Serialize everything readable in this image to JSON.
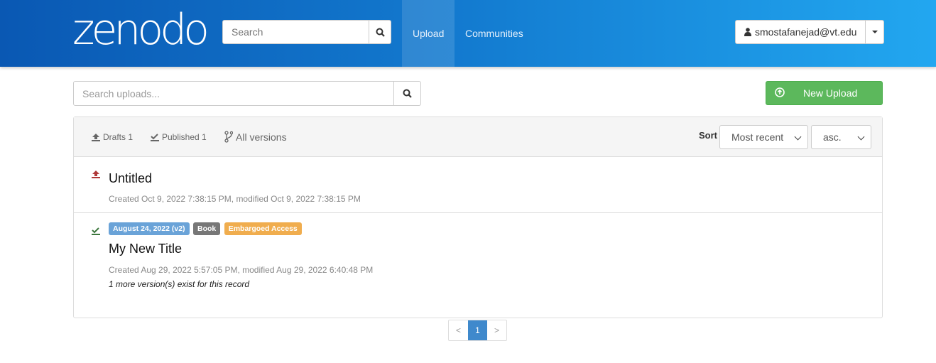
{
  "header": {
    "logo": "zenodo",
    "search_placeholder": "Search",
    "nav": [
      "Upload",
      "Communities"
    ],
    "user": "smostafanejad@vt.edu"
  },
  "toolbar": {
    "search_placeholder": "Search uploads...",
    "new_upload": "New Upload"
  },
  "filters": {
    "drafts": "Drafts 1",
    "published": "Published 1",
    "all_versions": "All versions",
    "sort_label": "Sort",
    "sort_by": "Most recent",
    "order": "asc."
  },
  "records": [
    {
      "title": "Untitled",
      "status": "draft",
      "meta": "Created Oct 9, 2022 7:38:15 PM, modified Oct 9, 2022 7:38:15 PM"
    },
    {
      "title": "My New Title",
      "status": "published",
      "badges": [
        "August 24, 2022 (v2)",
        "Book",
        "Embargoed Access"
      ],
      "meta": "Created Aug 29, 2022 5:57:05 PM, modified Aug 29, 2022 6:40:48 PM",
      "note": "1 more version(s) exist for this record"
    }
  ],
  "pagination": {
    "prev": "<",
    "current": "1",
    "next": ">"
  },
  "colors": {
    "draft": "#b03a3a",
    "published": "#3c763d",
    "badge_version": "#6aa3d8",
    "badge_type": "#777777",
    "badge_access": "#f0ad4e",
    "primary": "#3f89cc",
    "success": "#5cb85c"
  }
}
